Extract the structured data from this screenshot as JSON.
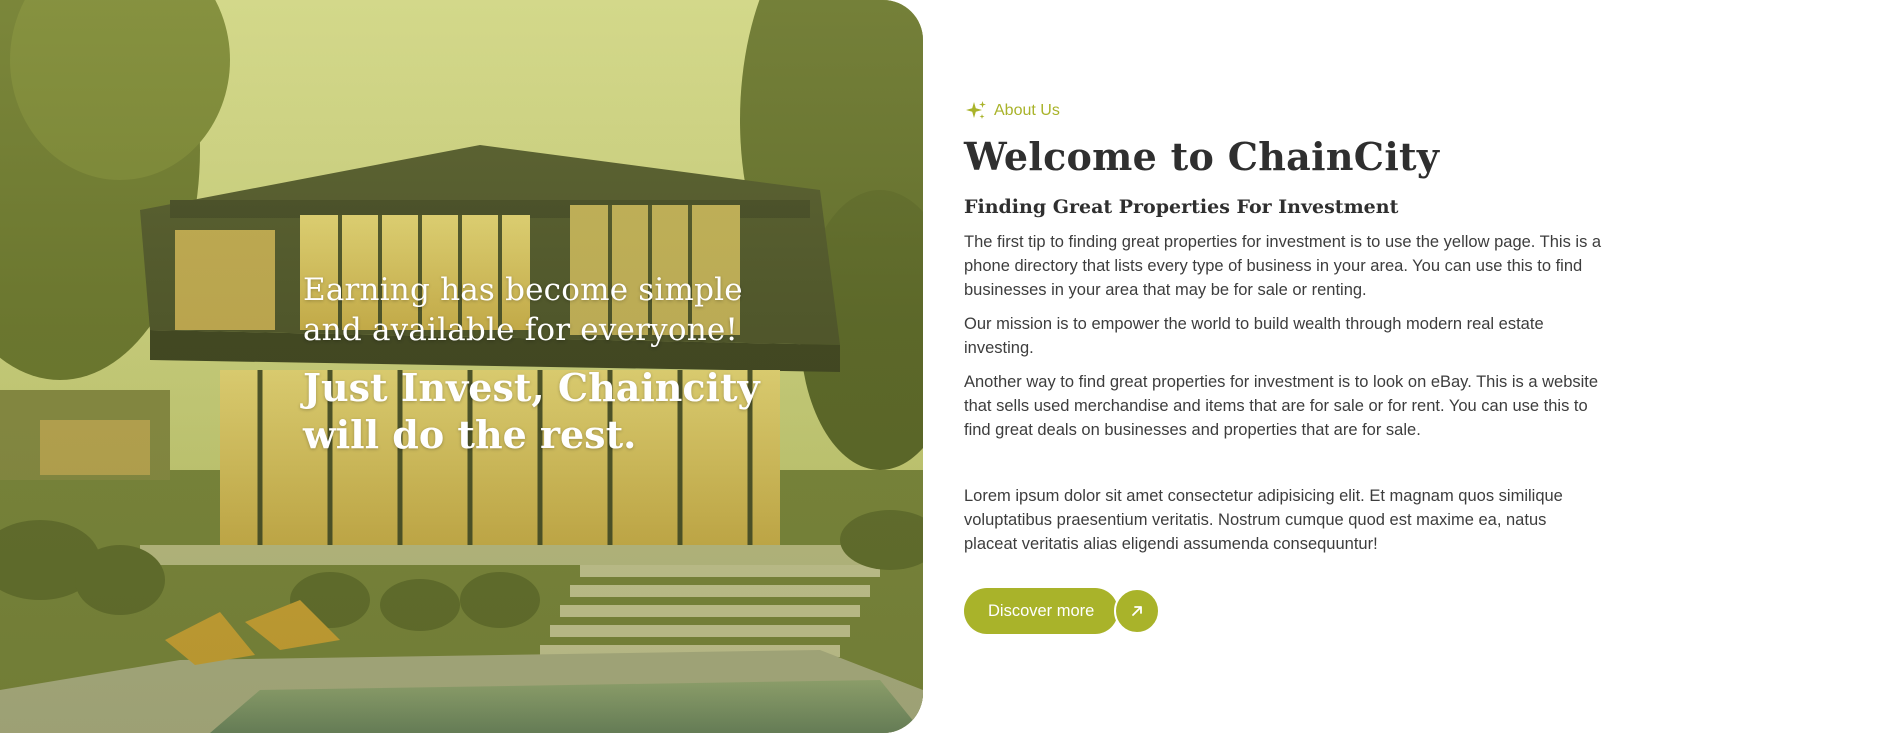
{
  "hero": {
    "line1": "Earning has become simple and available for everyone!",
    "line2": "Just Invest, Chaincity will do the rest."
  },
  "about": {
    "eyebrow_label": "About Us",
    "eyebrow_icon": "sparkle-icon",
    "title": "Welcome to ChainCity",
    "subtitle": "Finding Great Properties For Investment",
    "paragraphs": [
      "The first tip to finding great properties for investment is to use the yellow page. This is a phone directory that lists every type of business in your area. You can use this to find businesses in your area that may be for sale or renting.",
      "Our mission is to empower the world to build wealth through modern real estate investing.",
      "Another way to find great properties for investment is to look on eBay. This is a website that sells used merchandise and items that are for sale or for rent. You can use this to find great deals on businesses and properties that are for sale.",
      "Lorem ipsum dolor sit amet consectetur adipisicing elit. Et magnam quos similique voluptatibus praesentium veritatis. Nostrum cumque quod est maxime ea, natus placeat veritatis alias eligendi assumenda consequuntur!"
    ],
    "cta_label": "Discover more",
    "cta_icon": "arrow-up-right-icon"
  },
  "colors": {
    "accent": "#a9b32a",
    "heading": "#2f2f2f",
    "body_text": "#3d3d3d"
  }
}
